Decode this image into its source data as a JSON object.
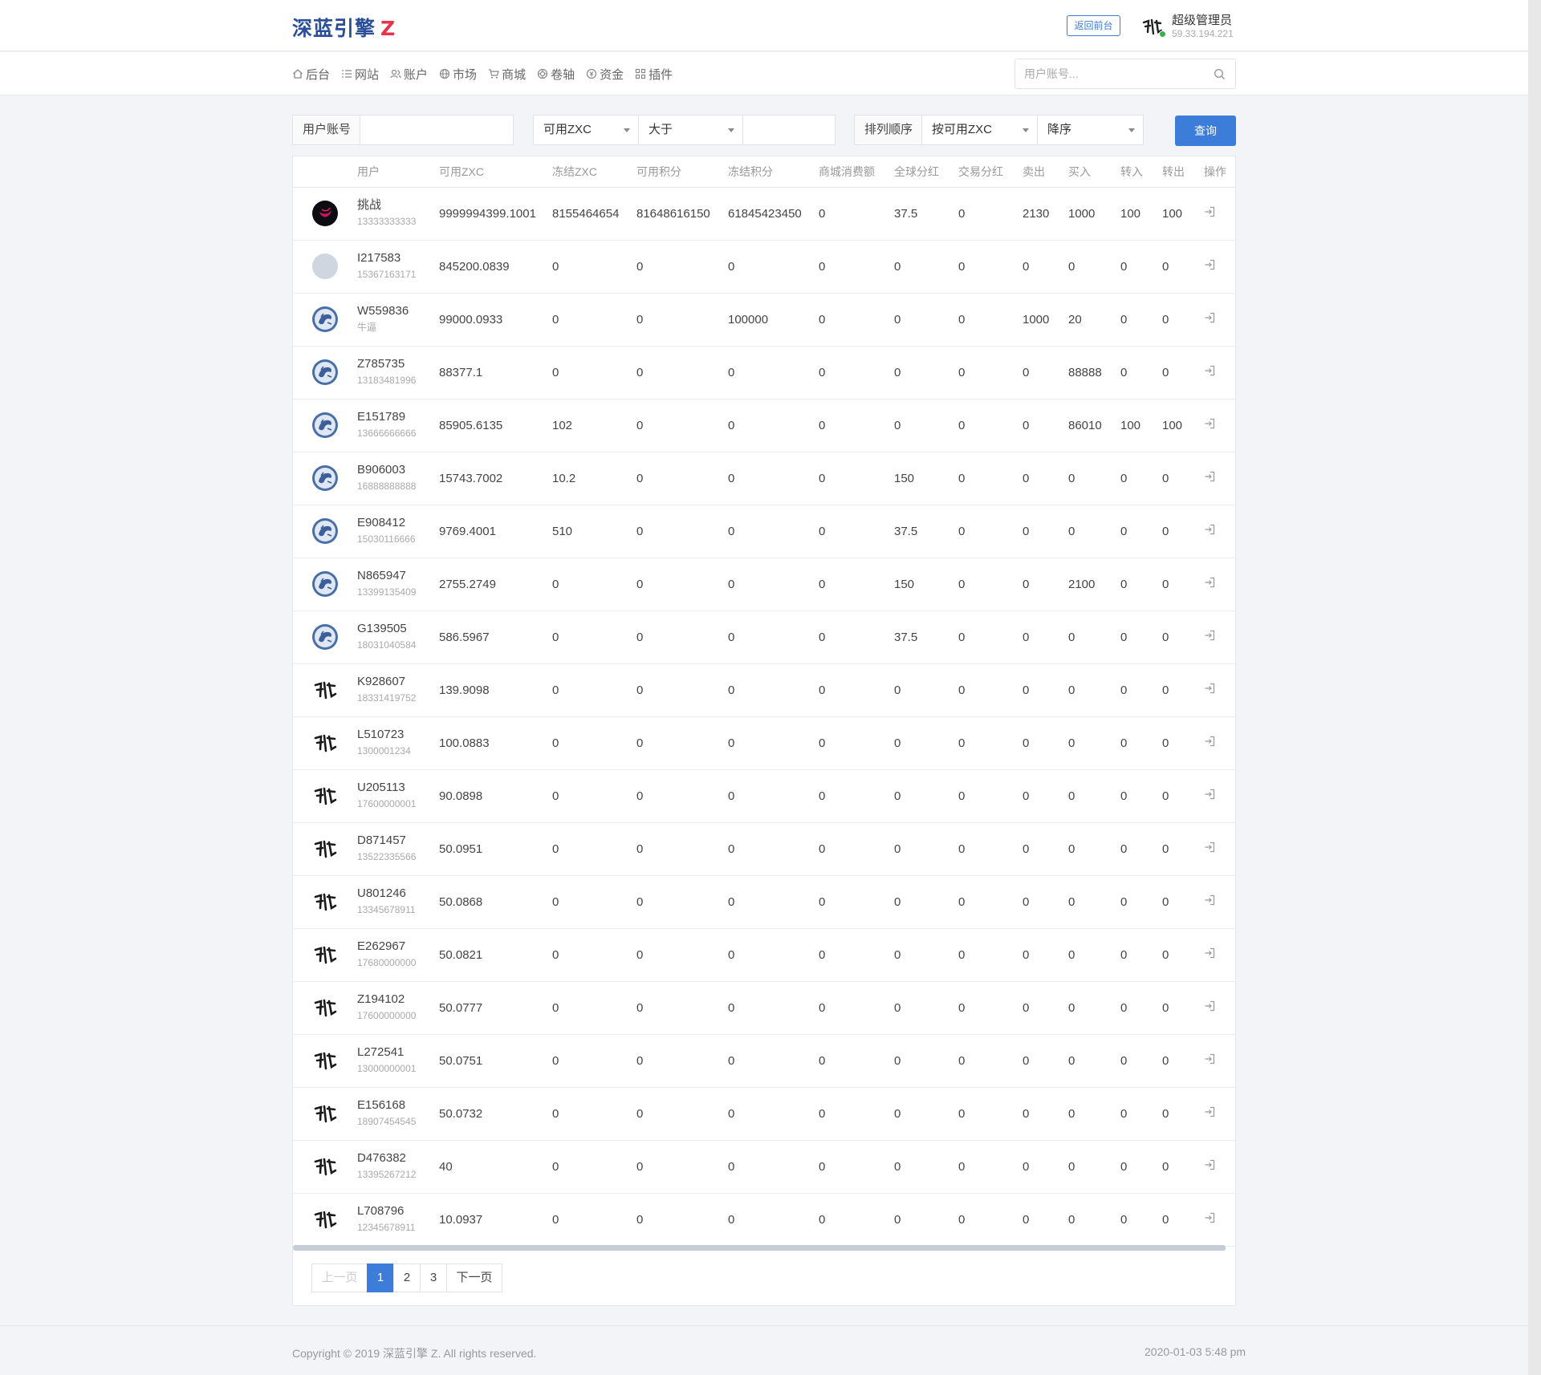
{
  "header": {
    "logo_text": "深蓝引擎",
    "logo_z": "Z",
    "back_button": "返回前台",
    "admin_name": "超级管理员",
    "admin_ip": "59.33.194.221"
  },
  "nav": {
    "items": [
      {
        "label": "后台",
        "icon": "home-icon"
      },
      {
        "label": "网站",
        "icon": "list-icon"
      },
      {
        "label": "账户",
        "icon": "users-icon"
      },
      {
        "label": "市场",
        "icon": "globe-icon"
      },
      {
        "label": "商城",
        "icon": "cart-icon"
      },
      {
        "label": "卷轴",
        "icon": "scroll-icon"
      },
      {
        "label": "资金",
        "icon": "coin-icon"
      },
      {
        "label": "插件",
        "icon": "grid-icon"
      }
    ],
    "search_placeholder": "用户账号..."
  },
  "filter": {
    "account_label": "用户账号",
    "account_value": "",
    "field_select": "可用ZXC",
    "operator_select": "大于",
    "amount_value": "",
    "order_label": "排列顺序",
    "order_field": "按可用ZXC",
    "order_dir": "降序",
    "query_button": "查询"
  },
  "table": {
    "headers": [
      "",
      "用户",
      "可用ZXC",
      "冻结ZXC",
      "可用积分",
      "冻结积分",
      "商城消费额",
      "全球分红",
      "交易分红",
      "卖出",
      "买入",
      "转入",
      "转出",
      "操作"
    ],
    "rows": [
      {
        "avatar": "dark",
        "name": "挑战",
        "sub": "13333333333",
        "zxc": "9999994399.1001",
        "frozen_zxc": "8155464654",
        "points": "81648616150",
        "frozen_points": "61845423450",
        "mall": "0",
        "global": "37.5",
        "trade": "0",
        "sell": "2130",
        "buy": "1000",
        "in": "100",
        "out": "100"
      },
      {
        "avatar": "gray",
        "name": "I217583",
        "sub": "15367163171",
        "zxc": "845200.0839",
        "frozen_zxc": "0",
        "points": "0",
        "frozen_points": "0",
        "mall": "0",
        "global": "0",
        "trade": "0",
        "sell": "0",
        "buy": "0",
        "in": "0",
        "out": "0"
      },
      {
        "avatar": "blue",
        "name": "W559836",
        "sub": "牛逼",
        "zxc": "99000.0933",
        "frozen_zxc": "0",
        "points": "0",
        "frozen_points": "100000",
        "mall": "0",
        "global": "0",
        "trade": "0",
        "sell": "1000",
        "buy": "20",
        "in": "0",
        "out": "0"
      },
      {
        "avatar": "blue",
        "name": "Z785735",
        "sub": "13183481996",
        "zxc": "88377.1",
        "frozen_zxc": "0",
        "points": "0",
        "frozen_points": "0",
        "mall": "0",
        "global": "0",
        "trade": "0",
        "sell": "0",
        "buy": "88888",
        "in": "0",
        "out": "0"
      },
      {
        "avatar": "blue",
        "name": "E151789",
        "sub": "13666666666",
        "zxc": "85905.6135",
        "frozen_zxc": "102",
        "points": "0",
        "frozen_points": "0",
        "mall": "0",
        "global": "0",
        "trade": "0",
        "sell": "0",
        "buy": "86010",
        "in": "100",
        "out": "100"
      },
      {
        "avatar": "blue",
        "name": "B906003",
        "sub": "16888888888",
        "zxc": "15743.7002",
        "frozen_zxc": "10.2",
        "points": "0",
        "frozen_points": "0",
        "mall": "0",
        "global": "150",
        "trade": "0",
        "sell": "0",
        "buy": "0",
        "in": "0",
        "out": "0"
      },
      {
        "avatar": "blue",
        "name": "E908412",
        "sub": "15030116666",
        "zxc": "9769.4001",
        "frozen_zxc": "510",
        "points": "0",
        "frozen_points": "0",
        "mall": "0",
        "global": "37.5",
        "trade": "0",
        "sell": "0",
        "buy": "0",
        "in": "0",
        "out": "0"
      },
      {
        "avatar": "blue",
        "name": "N865947",
        "sub": "13399135409",
        "zxc": "2755.2749",
        "frozen_zxc": "0",
        "points": "0",
        "frozen_points": "0",
        "mall": "0",
        "global": "150",
        "trade": "0",
        "sell": "0",
        "buy": "2100",
        "in": "0",
        "out": "0"
      },
      {
        "avatar": "blue",
        "name": "G139505",
        "sub": "18031040584",
        "zxc": "586.5967",
        "frozen_zxc": "0",
        "points": "0",
        "frozen_points": "0",
        "mall": "0",
        "global": "37.5",
        "trade": "0",
        "sell": "0",
        "buy": "0",
        "in": "0",
        "out": "0"
      },
      {
        "avatar": "ink",
        "name": "K928607",
        "sub": "18331419752",
        "zxc": "139.9098",
        "frozen_zxc": "0",
        "points": "0",
        "frozen_points": "0",
        "mall": "0",
        "global": "0",
        "trade": "0",
        "sell": "0",
        "buy": "0",
        "in": "0",
        "out": "0"
      },
      {
        "avatar": "ink",
        "name": "L510723",
        "sub": "1300001234",
        "zxc": "100.0883",
        "frozen_zxc": "0",
        "points": "0",
        "frozen_points": "0",
        "mall": "0",
        "global": "0",
        "trade": "0",
        "sell": "0",
        "buy": "0",
        "in": "0",
        "out": "0"
      },
      {
        "avatar": "ink",
        "name": "U205113",
        "sub": "17600000001",
        "zxc": "90.0898",
        "frozen_zxc": "0",
        "points": "0",
        "frozen_points": "0",
        "mall": "0",
        "global": "0",
        "trade": "0",
        "sell": "0",
        "buy": "0",
        "in": "0",
        "out": "0"
      },
      {
        "avatar": "ink",
        "name": "D871457",
        "sub": "13522335566",
        "zxc": "50.0951",
        "frozen_zxc": "0",
        "points": "0",
        "frozen_points": "0",
        "mall": "0",
        "global": "0",
        "trade": "0",
        "sell": "0",
        "buy": "0",
        "in": "0",
        "out": "0"
      },
      {
        "avatar": "ink",
        "name": "U801246",
        "sub": "13345678911",
        "zxc": "50.0868",
        "frozen_zxc": "0",
        "points": "0",
        "frozen_points": "0",
        "mall": "0",
        "global": "0",
        "trade": "0",
        "sell": "0",
        "buy": "0",
        "in": "0",
        "out": "0"
      },
      {
        "avatar": "ink",
        "name": "E262967",
        "sub": "17680000000",
        "zxc": "50.0821",
        "frozen_zxc": "0",
        "points": "0",
        "frozen_points": "0",
        "mall": "0",
        "global": "0",
        "trade": "0",
        "sell": "0",
        "buy": "0",
        "in": "0",
        "out": "0"
      },
      {
        "avatar": "ink",
        "name": "Z194102",
        "sub": "17600000000",
        "zxc": "50.0777",
        "frozen_zxc": "0",
        "points": "0",
        "frozen_points": "0",
        "mall": "0",
        "global": "0",
        "trade": "0",
        "sell": "0",
        "buy": "0",
        "in": "0",
        "out": "0"
      },
      {
        "avatar": "ink",
        "name": "L272541",
        "sub": "13000000001",
        "zxc": "50.0751",
        "frozen_zxc": "0",
        "points": "0",
        "frozen_points": "0",
        "mall": "0",
        "global": "0",
        "trade": "0",
        "sell": "0",
        "buy": "0",
        "in": "0",
        "out": "0"
      },
      {
        "avatar": "ink",
        "name": "E156168",
        "sub": "18907454545",
        "zxc": "50.0732",
        "frozen_zxc": "0",
        "points": "0",
        "frozen_points": "0",
        "mall": "0",
        "global": "0",
        "trade": "0",
        "sell": "0",
        "buy": "0",
        "in": "0",
        "out": "0"
      },
      {
        "avatar": "ink",
        "name": "D476382",
        "sub": "13395267212",
        "zxc": "40",
        "frozen_zxc": "0",
        "points": "0",
        "frozen_points": "0",
        "mall": "0",
        "global": "0",
        "trade": "0",
        "sell": "0",
        "buy": "0",
        "in": "0",
        "out": "0"
      },
      {
        "avatar": "ink",
        "name": "L708796",
        "sub": "12345678911",
        "zxc": "10.0937",
        "frozen_zxc": "0",
        "points": "0",
        "frozen_points": "0",
        "mall": "0",
        "global": "0",
        "trade": "0",
        "sell": "0",
        "buy": "0",
        "in": "0",
        "out": "0"
      }
    ]
  },
  "pagination": {
    "prev": "上一页",
    "pages": [
      "1",
      "2",
      "3"
    ],
    "current": "1",
    "next": "下一页"
  },
  "footer": {
    "copyright": "Copyright © 2019 深蓝引擎 Z. All rights reserved.",
    "datetime": "2020-01-03 5:48 pm"
  }
}
